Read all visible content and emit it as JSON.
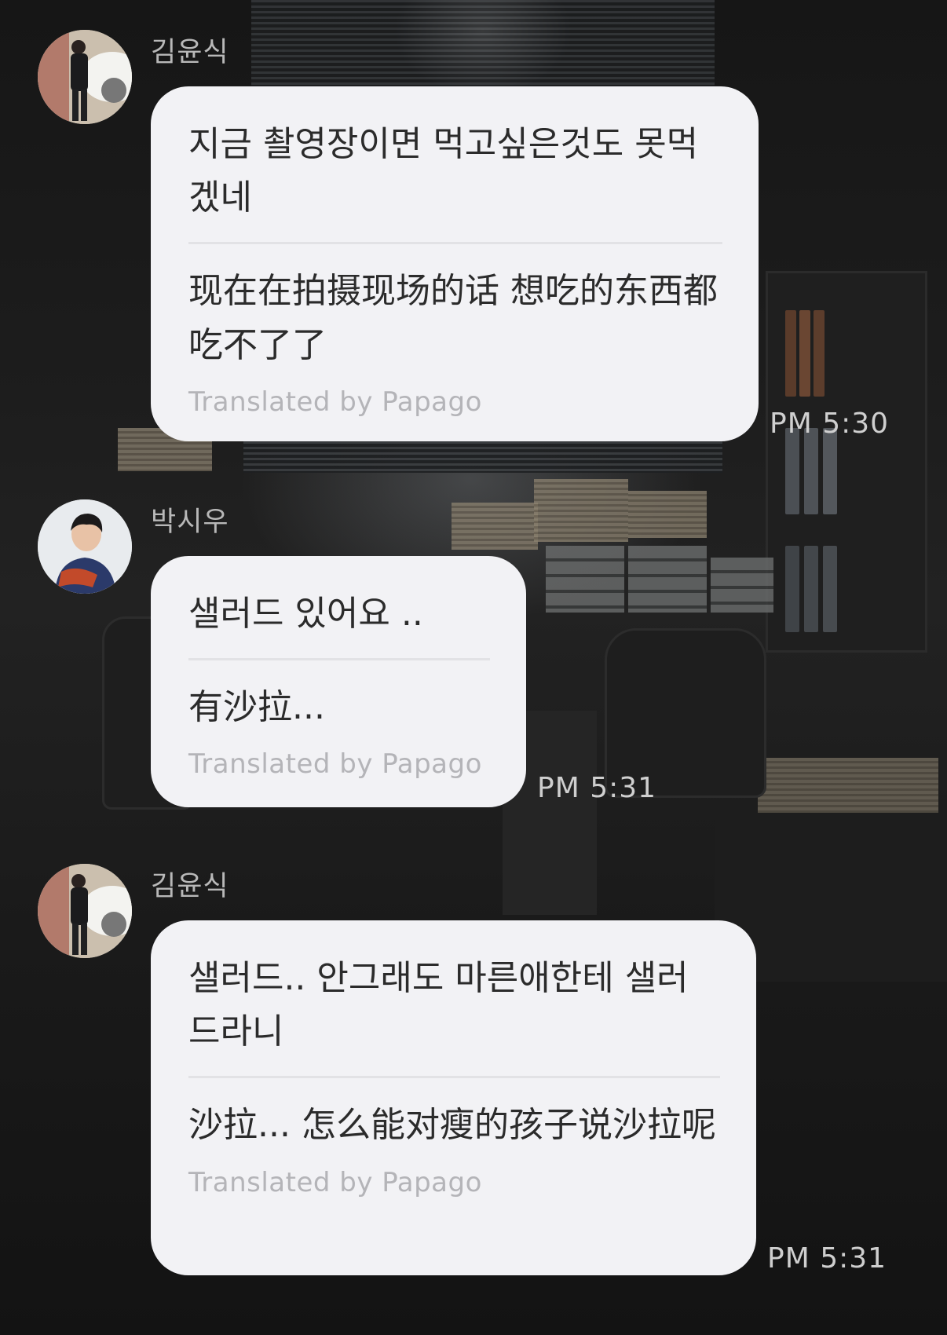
{
  "messages": [
    {
      "sender": "김윤식",
      "avatar": "avatar-kim",
      "original": "지금 촬영장이면 먹고싶은것도 못먹겠네",
      "translation": "现在在拍摄现场的话 想吃的东西都吃不了了",
      "credit": "Translated by Papago",
      "time": "PM 5:30"
    },
    {
      "sender": "박시우",
      "avatar": "avatar-park",
      "original": "샐러드 있어요 ..",
      "translation": "有沙拉...",
      "credit": "Translated by Papago",
      "time": "PM 5:31"
    },
    {
      "sender": "김윤식",
      "avatar": "avatar-kim",
      "original": "샐러드.. 안그래도 마른애한테 샐러드라니",
      "translation": "沙拉... 怎么能对瘦的孩子说沙拉呢",
      "credit": "Translated by Papago",
      "time": "PM 5:31"
    }
  ]
}
